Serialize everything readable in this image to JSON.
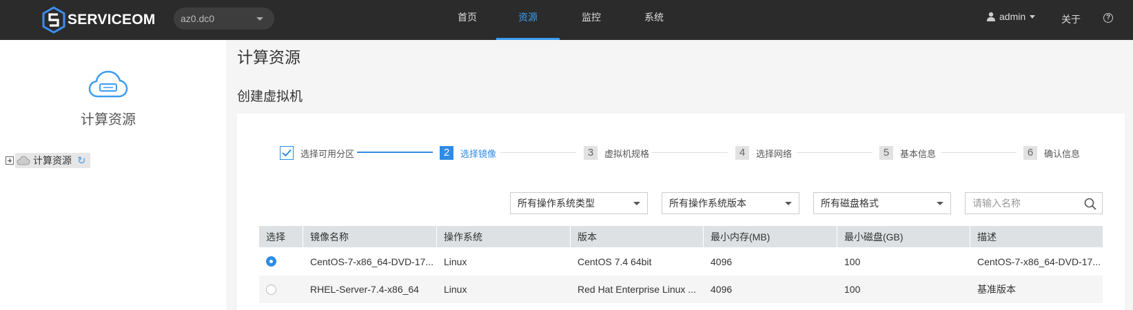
{
  "header": {
    "logo_text": "SERVICEOM",
    "az_select": "az0.dc0",
    "nav": [
      {
        "label": "首页",
        "active": false
      },
      {
        "label": "资源",
        "active": true
      },
      {
        "label": "监控",
        "active": false
      },
      {
        "label": "系统",
        "active": false
      }
    ],
    "user": "admin",
    "about": "关于",
    "help": "?"
  },
  "sidebar": {
    "title": "计算资源",
    "tree_node": "计算资源"
  },
  "main": {
    "page_title": "计算资源",
    "section_title": "创建虚拟机",
    "steps": [
      {
        "num": "1",
        "label": "选择可用分区",
        "state": "done"
      },
      {
        "num": "2",
        "label": "选择镜像",
        "state": "active"
      },
      {
        "num": "3",
        "label": "虚拟机规格",
        "state": "todo"
      },
      {
        "num": "4",
        "label": "选择网络",
        "state": "todo"
      },
      {
        "num": "5",
        "label": "基本信息",
        "state": "todo"
      },
      {
        "num": "6",
        "label": "确认信息",
        "state": "todo"
      }
    ],
    "filters": {
      "os_type": "所有操作系统类型",
      "os_version": "所有操作系统版本",
      "disk_format": "所有磁盘格式",
      "search_placeholder": "请输入名称"
    },
    "table": {
      "columns": [
        "选择",
        "镜像名称",
        "操作系统",
        "版本",
        "最小内存(MB)",
        "最小磁盘(GB)",
        "描述"
      ],
      "rows": [
        {
          "selected": true,
          "name": "CentOS-7-x86_64-DVD-17...",
          "os": "Linux",
          "version": "CentOS 7.4 64bit",
          "min_mem": "4096",
          "min_disk": "100",
          "desc": "CentOS-7-x86_64-DVD-17..."
        },
        {
          "selected": false,
          "name": "RHEL-Server-7.4-x86_64",
          "os": "Linux",
          "version": "Red Hat Enterprise Linux ...",
          "min_mem": "4096",
          "min_disk": "100",
          "desc": "基准版本"
        }
      ]
    }
  },
  "colors": {
    "accent": "#2e8be6",
    "topbar": "#2b2b2b"
  }
}
